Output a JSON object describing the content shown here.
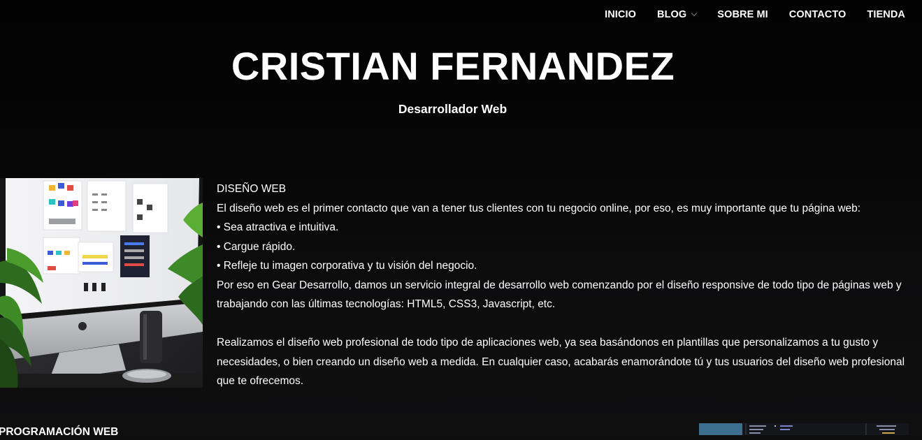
{
  "nav": {
    "items": [
      {
        "label": "INICIO",
        "has_dropdown": false
      },
      {
        "label": "BLOG",
        "has_dropdown": true
      },
      {
        "label": "SOBRE MI",
        "has_dropdown": false
      },
      {
        "label": "CONTACTO",
        "has_dropdown": false
      },
      {
        "label": "TIENDA",
        "has_dropdown": false
      }
    ]
  },
  "hero": {
    "title": "CRISTIAN FERNANDEZ",
    "subtitle": "Desarrollador Web"
  },
  "section_design": {
    "heading": "DISEÑO WEB",
    "intro": "El diseño web es el primer contacto que van a tener tus clientes con tu negocio online, por eso, es muy importante que tu página web:",
    "bullets": [
      "• Sea atractiva e intuitiva.",
      "• Cargue rápido.",
      "• Refleje tu imagen corporativa y tu visión del negocio."
    ],
    "paragraph_1": "Por eso en Gear Desarrollo, damos un servicio integral de desarrollo web comenzando por el diseño responsive de todo tipo de páginas web y trabajando con las últimas tecnologías: HTML5, CSS3, Javascript, etc.",
    "paragraph_2": "Realizamos el diseño web profesional de todo tipo de aplicaciones web, ya sea basándonos en plantillas que personalizamos a tu gusto y necesidades, o bien creando un diseño web a medida. En cualquier caso, acabarás enamorándote tú y tus usuarios del diseño web profesional que te ofrecemos."
  },
  "section_programming": {
    "heading": "PROGRAMACIÓN WEB"
  },
  "colors": {
    "background": "#0e0e0f",
    "text": "#ffffff"
  }
}
